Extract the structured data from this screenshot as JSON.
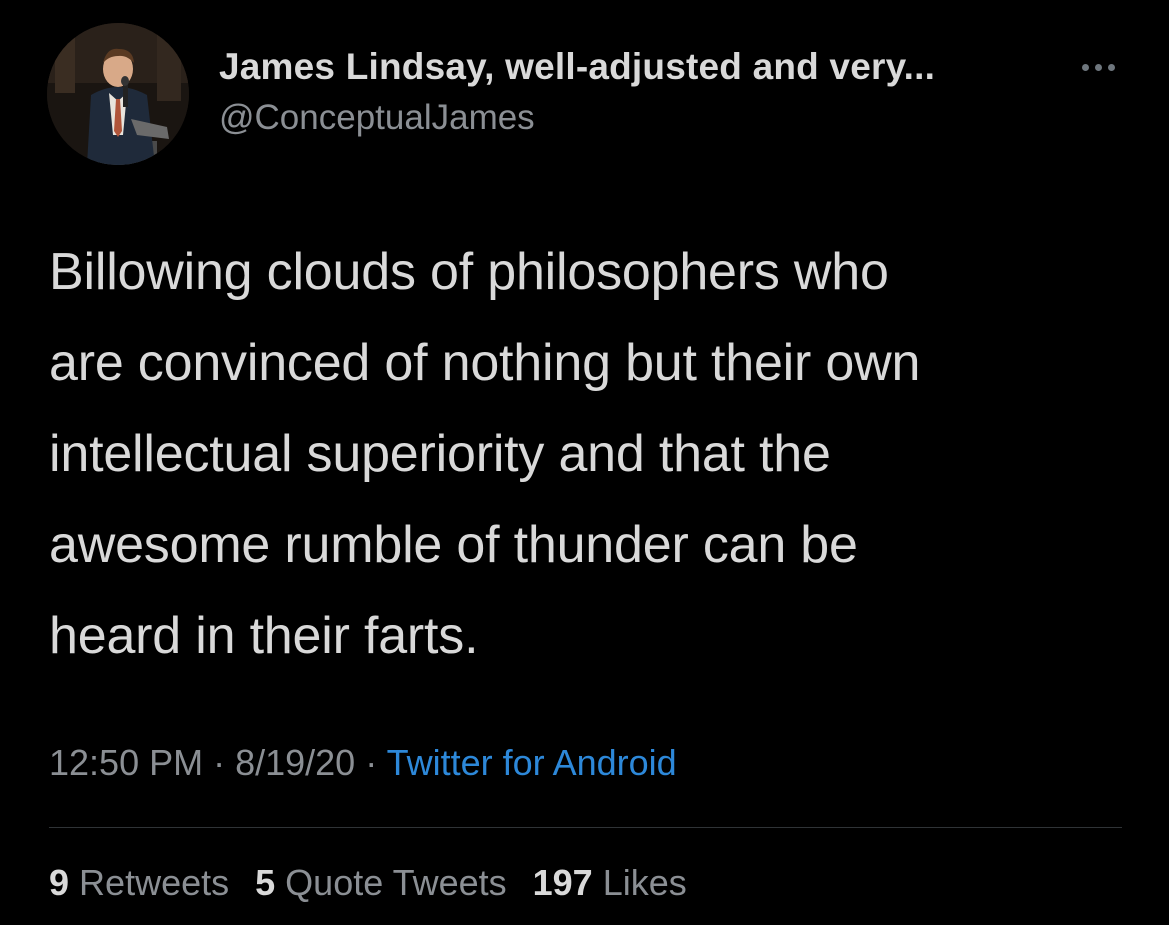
{
  "author": {
    "display_name": "James Lindsay, well-adjusted and very...",
    "handle": "@ConceptualJames"
  },
  "tweet": {
    "text": "Billowing clouds of philosophers who\nare convinced of nothing but their own\nintellectual superiority and that the\nawesome rumble of thunder can be\nheard in their farts.",
    "time": "12:50 PM",
    "date": "8/19/20",
    "separator": " · ",
    "source": "Twitter for Android"
  },
  "stats": {
    "retweets": {
      "count": "9",
      "label": "Retweets"
    },
    "quote_tweets": {
      "count": "5",
      "label": "Quote Tweets"
    },
    "likes": {
      "count": "197",
      "label": "Likes"
    }
  },
  "icons": {
    "more": "more-options-icon"
  },
  "colors": {
    "background": "#000000",
    "text": "#d9d9d9",
    "secondary_text": "#8b8f94",
    "link": "#2d88d9",
    "divider": "#2f3336"
  }
}
